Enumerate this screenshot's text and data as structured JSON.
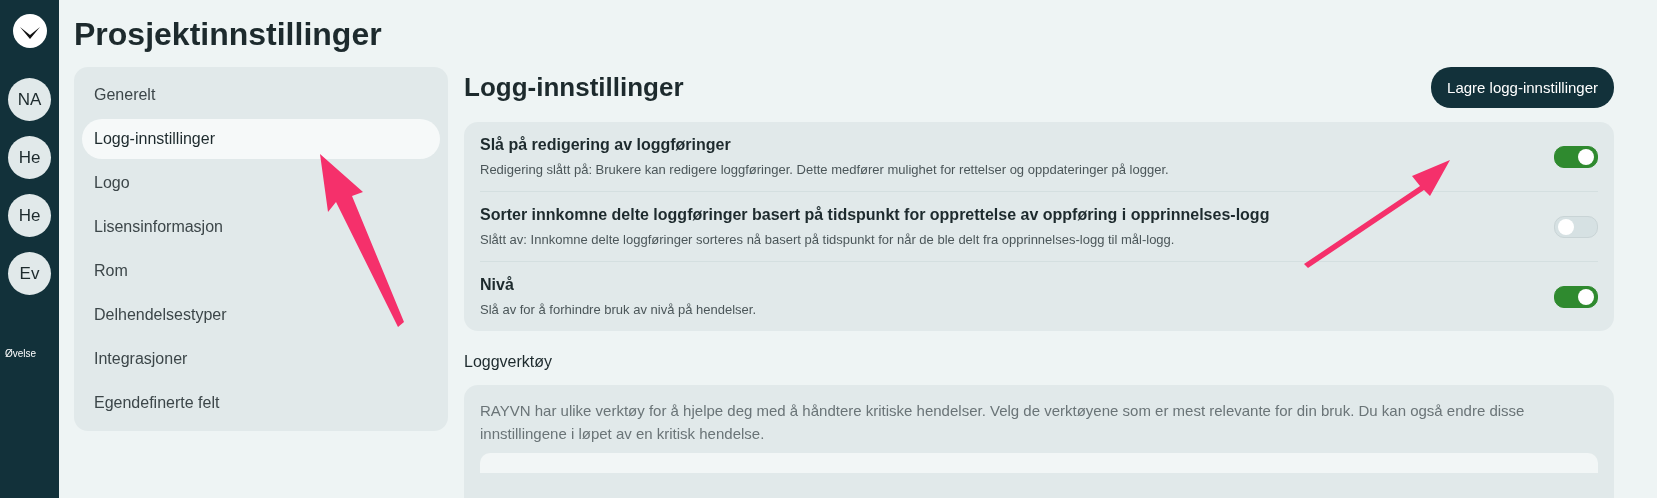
{
  "rail": {
    "avatars": [
      {
        "initials": "NA"
      },
      {
        "initials": "He"
      },
      {
        "initials": "He"
      },
      {
        "initials": "Ev"
      }
    ],
    "label": "Øvelse"
  },
  "title": "Prosjektinnstillinger",
  "nav": [
    {
      "label": "Generelt",
      "selected": false
    },
    {
      "label": "Logg-innstillinger",
      "selected": true
    },
    {
      "label": "Logo",
      "selected": false
    },
    {
      "label": "Lisensinformasjon",
      "selected": false
    },
    {
      "label": "Rom",
      "selected": false
    },
    {
      "label": "Delhendelsestyper",
      "selected": false
    },
    {
      "label": "Integrasjoner",
      "selected": false
    },
    {
      "label": "Egendefinerte felt",
      "selected": false
    }
  ],
  "section": {
    "heading": "Logg-innstillinger",
    "save_button": "Lagre logg-innstillinger"
  },
  "settings": [
    {
      "title": "Slå på redigering av loggføringer",
      "description": "Redigering slått på: Brukere kan redigere loggføringer. Dette medfører mulighet for rettelser og oppdateringer på logger.",
      "on": true
    },
    {
      "title": "Sorter innkomne delte loggføringer basert på tidspunkt for opprettelse av oppføring i opprinnelses-logg",
      "description": "Slått av: Innkomne delte loggføringer sorteres nå basert på tidspunkt for når de ble delt fra opprinnelses-logg til mål-logg.",
      "on": false
    },
    {
      "title": "Nivå",
      "description": "Slå av for å forhindre bruk av nivå på hendelser.",
      "on": true
    }
  ],
  "tools": {
    "heading": "Loggverktøy",
    "description": "RAYVN har ulike verktøy for å hjelpe deg med å håndtere kritiske hendelser. Velg de verktøyene som er mest relevante for din bruk. Du kan også endre disse innstillingene i løpet av en kritisk hendelse."
  }
}
